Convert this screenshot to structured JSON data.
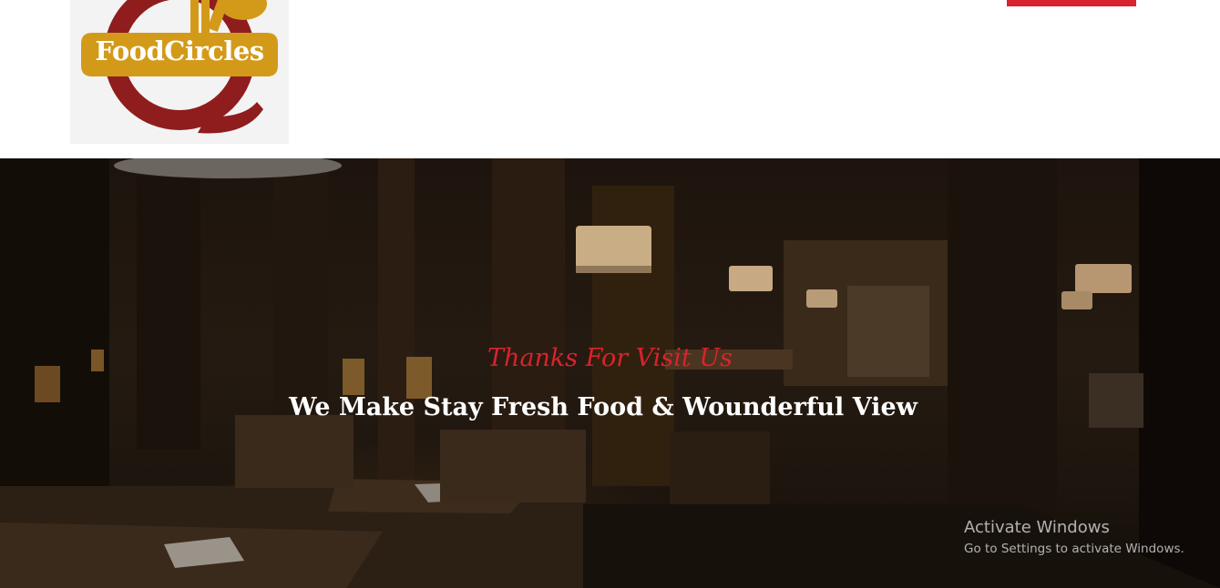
{
  "brand": {
    "logo_text": "FoodCircles",
    "colors": {
      "logo_red": "#8f1d1e",
      "logo_gold": "#d39a1a",
      "accent_red": "#d9232e"
    }
  },
  "hero": {
    "subtitle": "Thanks For Visit Us",
    "headline": "We Make Stay Fresh Food & Wounderful View"
  },
  "watermark": {
    "title": "Activate Windows",
    "subtitle": "Go to Settings to activate Windows."
  }
}
